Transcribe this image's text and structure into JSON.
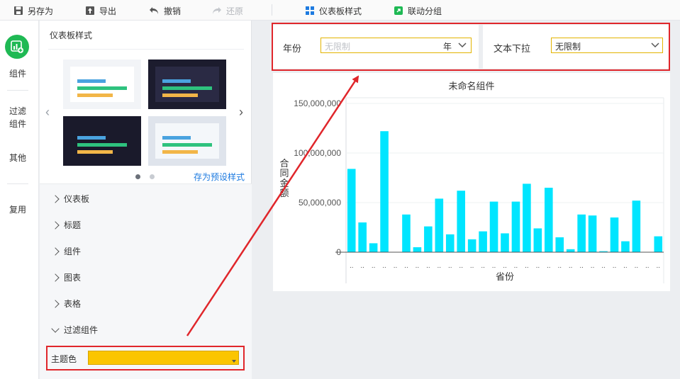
{
  "toolbar": {
    "save_as": "另存为",
    "export": "导出",
    "undo": "撤销",
    "redo": "还原",
    "dashboard_style": "仪表板样式",
    "linkage_group": "联动分组"
  },
  "rail": {
    "items": [
      "组件",
      "过滤\n组件",
      "其他",
      "复用"
    ]
  },
  "panel": {
    "title": "仪表板样式",
    "save_preset": "存为预设样式",
    "accordion": [
      "仪表板",
      "标题",
      "组件",
      "图表",
      "表格",
      "过滤组件"
    ],
    "theme_color_label": "主题色",
    "theme_color": "#FBC500"
  },
  "filters": {
    "year": {
      "label": "年份",
      "placeholder": "无限制",
      "unit": "年"
    },
    "text_dropdown": {
      "label": "文本下拉",
      "value": "无限制"
    }
  },
  "colors": {
    "accent": "#1fb954",
    "annotation": "#e0262b",
    "bar": "#00e5ff",
    "link": "#1e7be0"
  },
  "chart_data": {
    "type": "bar",
    "title": "未命名组件",
    "xlabel": "省份",
    "ylabel": "合同金额",
    "ylim": [
      0,
      150000000
    ],
    "yticks": [
      "150,000,000",
      "100,000,000",
      "50,000,000",
      "0"
    ],
    "ytick_values": [
      150000000,
      100000000,
      50000000,
      0
    ],
    "category_label": "..",
    "values": [
      84000000,
      30000000,
      9000000,
      122000000,
      0,
      38000000,
      5000000,
      26000000,
      54000000,
      18000000,
      62000000,
      13000000,
      21000000,
      51000000,
      19000000,
      51000000,
      69000000,
      24000000,
      65000000,
      15000000,
      3000000,
      38000000,
      37000000,
      1000000,
      35000000,
      11000000,
      52000000,
      0,
      16000000
    ]
  }
}
